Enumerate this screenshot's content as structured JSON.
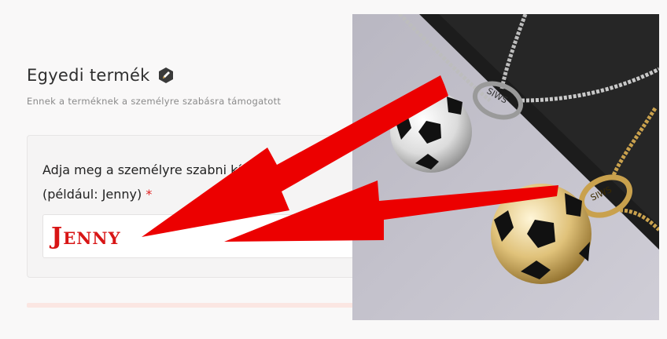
{
  "product": {
    "title": "Egyedi termék",
    "edit_icon": "pencil-icon",
    "subtitle": "Ennek a terméknek a személyre szabásra támogatott"
  },
  "personalization": {
    "label_line1": "Adja meg a személyre szabni kívánt nevet",
    "label_line2": "(például: Jenny)",
    "required_marker": "*",
    "input_value": "Jenny"
  },
  "photo": {
    "engraving_silver": "SIWS",
    "engraving_gold": "SIWS"
  },
  "colors": {
    "accent_red": "#e00000",
    "input_text_red": "#d81515"
  }
}
